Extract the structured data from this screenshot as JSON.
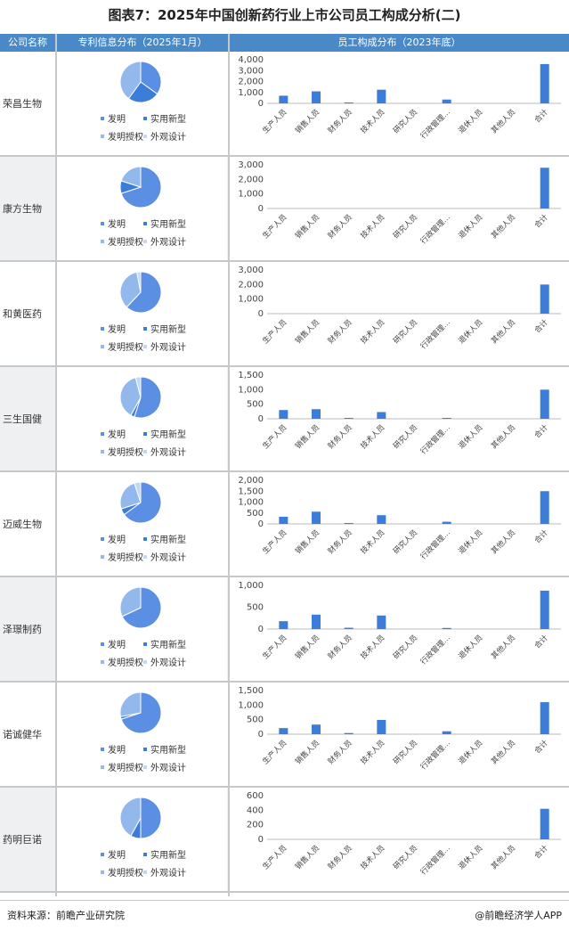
{
  "title": "图表7：2025年中国创新药行业上市公司员工构成分析(二)",
  "headers": {
    "company": "公司名称",
    "patent": "专利信息分布（2025年1月）",
    "staff": "员工构成分布（2023年底）"
  },
  "legend": {
    "invention": "发明",
    "utility": "实用新型",
    "grant": "发明授权",
    "design": "外观设计"
  },
  "colors": {
    "bar": "#3b7dd8",
    "invention": "#5b8fe3",
    "utility": "#3b7dd8",
    "grant": "#93b8ec",
    "design": "#c3d7f4",
    "header": "#4a89c8"
  },
  "footer": {
    "source": "资料来源：前瞻产业研究院",
    "brand": "@前瞻经济学人APP"
  },
  "chart_data": [
    {
      "type": "pie",
      "company": "荣昌生物",
      "labels": [
        "发明",
        "实用新型",
        "发明授权",
        "外观设计"
      ],
      "values": [
        35,
        25,
        40,
        0
      ],
      "bar": {
        "type": "bar",
        "categories": [
          "生产人员",
          "销售人员",
          "财务人员",
          "技术人员",
          "研究人员",
          "行政管理人员",
          "退休人员",
          "其他人员",
          "合计"
        ],
        "values": [
          700,
          1100,
          80,
          1250,
          0,
          350,
          0,
          0,
          3600
        ],
        "yticks": [
          "0",
          "1,000",
          "2,000",
          "3,000",
          "4,000"
        ],
        "ylim": [
          0,
          4000
        ]
      }
    },
    {
      "type": "pie",
      "company": "康方生物",
      "labels": [
        "发明",
        "实用新型",
        "发明授权",
        "外观设计"
      ],
      "values": [
        70,
        10,
        20,
        0
      ],
      "bar": {
        "type": "bar",
        "categories": [
          "生产人员",
          "销售人员",
          "财务人员",
          "技术人员",
          "研究人员",
          "行政管理人员",
          "退休人员",
          "其他人员",
          "合计"
        ],
        "values": [
          0,
          0,
          0,
          0,
          0,
          0,
          0,
          0,
          2800
        ],
        "yticks": [
          "0",
          "1,000",
          "2,000",
          "3,000"
        ],
        "ylim": [
          0,
          3000
        ]
      }
    },
    {
      "type": "pie",
      "company": "和黄医药",
      "labels": [
        "发明",
        "实用新型",
        "发明授权",
        "外观设计"
      ],
      "values": [
        62,
        0,
        35,
        3
      ],
      "bar": {
        "type": "bar",
        "categories": [
          "生产人员",
          "销售人员",
          "财务人员",
          "技术人员",
          "研究人员",
          "行政管理人员",
          "退休人员",
          "其他人员",
          "合计"
        ],
        "values": [
          0,
          0,
          0,
          0,
          0,
          0,
          0,
          0,
          2000
        ],
        "yticks": [
          "0",
          "1,000",
          "2,000",
          "3,000"
        ],
        "ylim": [
          0,
          3000
        ]
      }
    },
    {
      "type": "pie",
      "company": "三生国健",
      "labels": [
        "发明",
        "实用新型",
        "发明授权",
        "外观设计"
      ],
      "values": [
        55,
        3,
        38,
        4
      ],
      "bar": {
        "type": "bar",
        "categories": [
          "生产人员",
          "销售人员",
          "财务人员",
          "技术人员",
          "研究人员",
          "行政管理人员",
          "退休人员",
          "其他人员",
          "合计"
        ],
        "values": [
          300,
          330,
          30,
          230,
          0,
          30,
          0,
          0,
          1000
        ],
        "yticks": [
          "0",
          "500",
          "1,000",
          "1,500"
        ],
        "ylim": [
          0,
          1500
        ]
      }
    },
    {
      "type": "pie",
      "company": "迈威生物",
      "labels": [
        "发明",
        "实用新型",
        "发明授权",
        "外观设计"
      ],
      "values": [
        65,
        5,
        25,
        5
      ],
      "bar": {
        "type": "bar",
        "categories": [
          "生产人员",
          "销售人员",
          "财务人员",
          "技术人员",
          "研究人员",
          "行政管理人员",
          "退休人员",
          "其他人员",
          "合计"
        ],
        "values": [
          330,
          560,
          40,
          400,
          0,
          100,
          0,
          0,
          1500
        ],
        "yticks": [
          "0",
          "500",
          "1,000",
          "1,500",
          "2,000"
        ],
        "ylim": [
          0,
          2000
        ]
      }
    },
    {
      "type": "pie",
      "company": "泽璟制药",
      "labels": [
        "发明",
        "实用新型",
        "发明授权",
        "外观设计"
      ],
      "values": [
        68,
        0,
        32,
        0
      ],
      "bar": {
        "type": "bar",
        "categories": [
          "生产人员",
          "销售人员",
          "财务人员",
          "技术人员",
          "研究人员",
          "行政管理人员",
          "退休人员",
          "其他人员",
          "合计"
        ],
        "values": [
          180,
          330,
          30,
          310,
          0,
          25,
          0,
          0,
          880
        ],
        "yticks": [
          "0",
          "500",
          "1,000"
        ],
        "ylim": [
          0,
          1000
        ]
      }
    },
    {
      "type": "pie",
      "company": "诺诚健华",
      "labels": [
        "发明",
        "实用新型",
        "发明授权",
        "外观设计"
      ],
      "values": [
        70,
        2,
        28,
        0
      ],
      "bar": {
        "type": "bar",
        "categories": [
          "生产人员",
          "销售人员",
          "财务人员",
          "技术人员",
          "研究人员",
          "行政管理人员",
          "退休人员",
          "其他人员",
          "合计"
        ],
        "values": [
          210,
          330,
          40,
          490,
          0,
          100,
          0,
          0,
          1100
        ],
        "yticks": [
          "0",
          "500",
          "1,000",
          "1,500"
        ],
        "ylim": [
          0,
          1500
        ]
      }
    },
    {
      "type": "pie",
      "company": "药明巨诺",
      "labels": [
        "发明",
        "实用新型",
        "发明授权",
        "外观设计"
      ],
      "values": [
        50,
        8,
        42,
        0
      ],
      "bar": {
        "type": "bar",
        "categories": [
          "生产人员",
          "销售人员",
          "财务人员",
          "技术人员",
          "研究人员",
          "行政管理人员",
          "退休人员",
          "其他人员",
          "合计"
        ],
        "values": [
          0,
          0,
          0,
          0,
          0,
          0,
          0,
          0,
          420
        ],
        "yticks": [
          "0",
          "200",
          "400",
          "600"
        ],
        "ylim": [
          0,
          600
        ]
      }
    }
  ]
}
